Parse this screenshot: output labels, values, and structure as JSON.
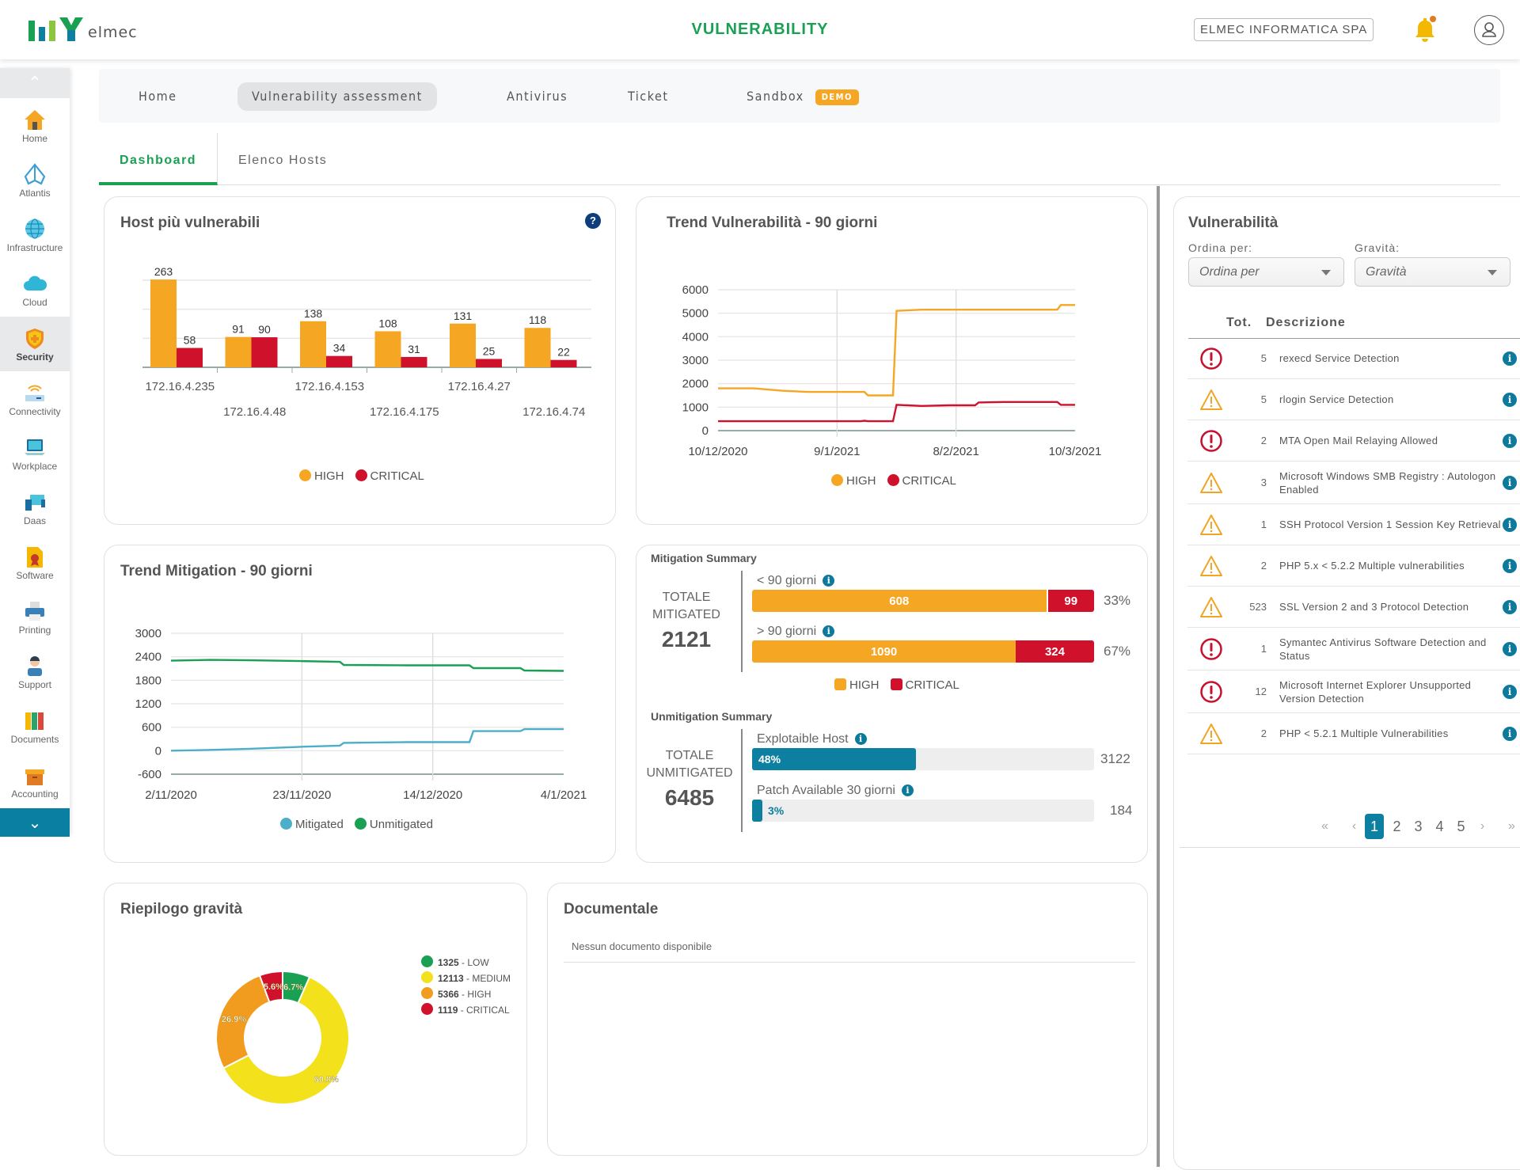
{
  "header": {
    "logo_text": "elmec",
    "title": "VULNERABILITY",
    "company": "ELMEC INFORMATICA SPA"
  },
  "sidebar": {
    "items": [
      {
        "label": "Home",
        "icon": "home-icon",
        "active": false
      },
      {
        "label": "Atlantis",
        "icon": "atlantis-icon",
        "active": false
      },
      {
        "label": "Infrastructure",
        "icon": "globe-icon",
        "active": false
      },
      {
        "label": "Cloud",
        "icon": "cloud-icon",
        "active": false
      },
      {
        "label": "Security",
        "icon": "shield-icon",
        "active": true
      },
      {
        "label": "Connectivity",
        "icon": "router-icon",
        "active": false
      },
      {
        "label": "Workplace",
        "icon": "laptop-icon",
        "active": false
      },
      {
        "label": "Daas",
        "icon": "devices-icon",
        "active": false
      },
      {
        "label": "Software",
        "icon": "certificate-icon",
        "active": false
      },
      {
        "label": "Printing",
        "icon": "printer-icon",
        "active": false
      },
      {
        "label": "Support",
        "icon": "support-agent-icon",
        "active": false
      },
      {
        "label": "Documents",
        "icon": "binders-icon",
        "active": false
      },
      {
        "label": "Accounting",
        "icon": "box-icon",
        "active": false
      }
    ]
  },
  "nav": {
    "items": [
      "Home",
      "Vulnerability assessment",
      "Antivirus",
      "Ticket",
      "Sandbox"
    ],
    "active": "Vulnerability assessment",
    "badge": "DEMO"
  },
  "tabs": {
    "items": [
      "Dashboard",
      "Elenco Hosts"
    ],
    "active": "Dashboard"
  },
  "colors": {
    "high": "#f5a623",
    "critical": "#d0112b",
    "green": "#1aa053",
    "teal": "#0d7fa1",
    "mitigated": "#4bafc9",
    "unmitigated": "#1aa053",
    "low": "#1aa053",
    "medium": "#f2e11b"
  },
  "cards": {
    "hosts_title": "Host più vulnerabili",
    "trend_vuln_title": "Trend Vulnerabilità - 90 giorni",
    "trend_mit_title": "Trend Mitigation - 90 giorni",
    "severity_title": "Riepilogo gravità",
    "docs_title": "Documentale",
    "docs_empty": "Nessun documento disponibile"
  },
  "chart_data": [
    {
      "type": "bar",
      "title": "Host più vulnerabili",
      "categories": [
        "172.16.4.235",
        "172.16.4.48",
        "172.16.4.153",
        "172.16.4.175",
        "172.16.4.27",
        "172.16.4.74"
      ],
      "series": [
        {
          "name": "HIGH",
          "values": [
            263,
            91,
            138,
            108,
            131,
            118
          ]
        },
        {
          "name": "CRITICAL",
          "values": [
            58,
            90,
            34,
            31,
            25,
            22
          ]
        }
      ],
      "ylim": [
        0,
        300
      ],
      "grid": true,
      "legend": "bottom"
    },
    {
      "type": "line",
      "title": "Trend Vulnerabilità - 90 giorni",
      "x_ticks": [
        "10/12/2020",
        "9/1/2021",
        "8/2/2021",
        "10/3/2021"
      ],
      "yticks": [
        0,
        1000,
        2000,
        3000,
        4000,
        5000,
        6000
      ],
      "ylim": [
        0,
        6000
      ],
      "x": [
        0,
        0.1,
        0.18,
        0.25,
        0.4,
        0.41,
        0.42,
        0.49,
        0.5,
        0.57,
        0.65,
        0.72,
        0.73,
        0.8,
        0.95,
        0.96,
        1.0
      ],
      "series": [
        {
          "name": "HIGH",
          "values": [
            1800,
            1800,
            1700,
            1650,
            1650,
            1650,
            1500,
            1500,
            5100,
            5150,
            5150,
            5150,
            5150,
            5150,
            5150,
            5350,
            5350
          ]
        },
        {
          "name": "CRITICAL",
          "values": [
            400,
            400,
            400,
            400,
            400,
            420,
            400,
            400,
            1100,
            1050,
            1080,
            1080,
            1200,
            1220,
            1220,
            1100,
            1100
          ]
        }
      ],
      "legend": "bottom"
    },
    {
      "type": "line",
      "title": "Trend Mitigation - 90 giorni",
      "x_ticks": [
        "2/11/2020",
        "23/11/2020",
        "14/12/2020",
        "4/1/2021"
      ],
      "yticks": [
        -600,
        0,
        600,
        1200,
        1800,
        2400,
        3000
      ],
      "ylim": [
        -600,
        3000
      ],
      "x": [
        0,
        0.1,
        0.2,
        0.33,
        0.43,
        0.44,
        0.6,
        0.76,
        0.77,
        0.89,
        0.9,
        1.0
      ],
      "series": [
        {
          "name": "Mitigated",
          "values": [
            0,
            20,
            50,
            100,
            130,
            200,
            220,
            220,
            500,
            500,
            550,
            550
          ]
        },
        {
          "name": "Unmitigated",
          "values": [
            2300,
            2320,
            2310,
            2290,
            2270,
            2190,
            2180,
            2180,
            2110,
            2110,
            2050,
            2040
          ]
        }
      ],
      "legend": "bottom"
    },
    {
      "type": "pie",
      "title": "Riepilogo gravità",
      "categories": [
        "LOW",
        "MEDIUM",
        "HIGH",
        "CRITICAL"
      ],
      "values": [
        1325,
        12113,
        5366,
        1119
      ],
      "labels": [
        "6.7%",
        "60.8%",
        "26.9%",
        "5.6%"
      ],
      "legend": "right"
    }
  ],
  "mitigation": {
    "title": "Mitigation Summary",
    "total_label_1": "TOTALE",
    "total_label_2": "MITIGATED",
    "total": "2121",
    "rows": [
      {
        "label": "< 90 giorni",
        "high": 608,
        "critical": 99,
        "high_text": "608",
        "critical_text": "99",
        "pct": "33%"
      },
      {
        "label": "> 90 giorni",
        "high": 1090,
        "critical": 324,
        "high_text": "1090",
        "critical_text": "324",
        "pct": "67%"
      }
    ],
    "legend": [
      "HIGH",
      "CRITICAL"
    ]
  },
  "unmitigation": {
    "title": "Unmitigation Summary",
    "total_label_1": "TOTALE",
    "total_label_2": "UNMITIGATED",
    "total": "6485",
    "rows": [
      {
        "label": "Explotaible Host",
        "fraction": 0.48,
        "pct": "48%",
        "count": "3122"
      },
      {
        "label": "Patch Available 30 giorni",
        "fraction": 0.03,
        "pct": "3%",
        "count": "184"
      }
    ]
  },
  "vulns": {
    "title": "Vulnerabilità",
    "sort_label": "Ordina per:",
    "sort_placeholder": "Ordina per",
    "severity_label": "Gravità:",
    "severity_placeholder": "Gravità",
    "col_tot": "Tot.",
    "col_desc": "Descrizione",
    "rows": [
      {
        "severity": "critical",
        "count": "5",
        "desc": "rexecd Service Detection"
      },
      {
        "severity": "high",
        "count": "5",
        "desc": "rlogin Service Detection"
      },
      {
        "severity": "critical",
        "count": "2",
        "desc": "MTA Open Mail Relaying Allowed"
      },
      {
        "severity": "high",
        "count": "3",
        "desc": "Microsoft Windows SMB Registry : Autologon Enabled"
      },
      {
        "severity": "high",
        "count": "1",
        "desc": "SSH Protocol Version 1 Session Key Retrieval"
      },
      {
        "severity": "high",
        "count": "2",
        "desc": "PHP 5.x < 5.2.2 Multiple vulnerabilities"
      },
      {
        "severity": "high",
        "count": "523",
        "desc": "SSL Version 2 and 3 Protocol Detection"
      },
      {
        "severity": "critical",
        "count": "1",
        "desc": "Symantec Antivirus Software Detection and Status"
      },
      {
        "severity": "critical",
        "count": "12",
        "desc": "Microsoft Internet Explorer Unsupported Version Detection"
      },
      {
        "severity": "high",
        "count": "2",
        "desc": "PHP < 5.2.1 Multiple Vulnerabilities"
      }
    ],
    "pagination": {
      "first": "«",
      "prev": "‹",
      "pages": [
        "1",
        "2",
        "3",
        "4",
        "5"
      ],
      "current": "1",
      "next": "›",
      "last": "»"
    }
  }
}
